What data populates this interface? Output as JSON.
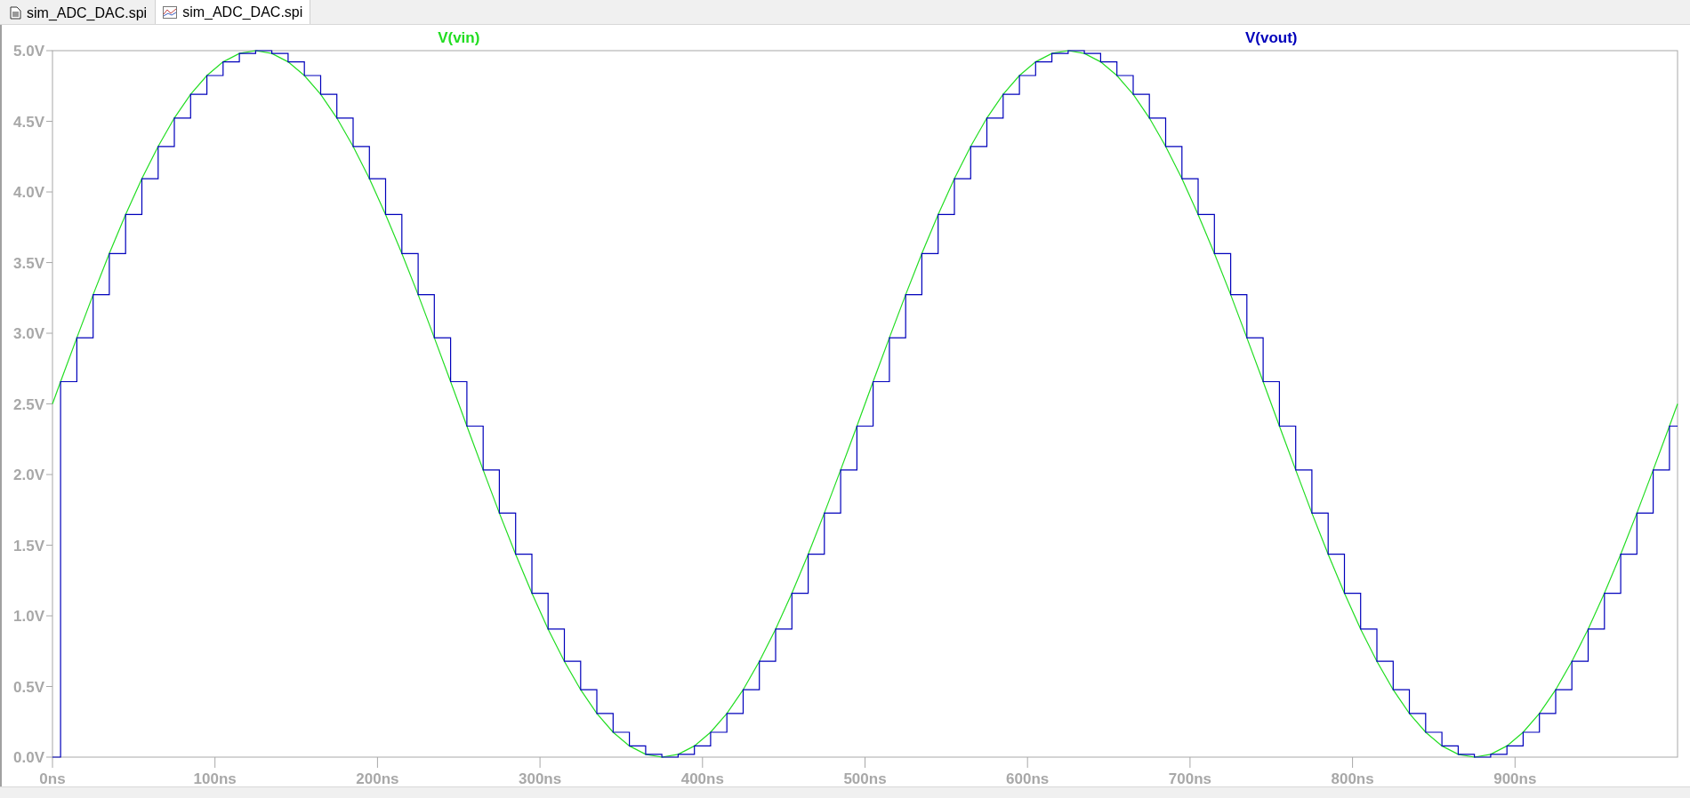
{
  "tabs": [
    {
      "label": "sim_ADC_DAC.spi",
      "kind": "netlist",
      "selected": false
    },
    {
      "label": "sim_ADC_DAC.spi",
      "kind": "waveform",
      "selected": true
    }
  ],
  "plot": {
    "chart_data": {
      "type": "line",
      "xlim": [
        0,
        1000
      ],
      "ylim": [
        0,
        5
      ],
      "xticks": [
        {
          "value": 0,
          "label": "0ns"
        },
        {
          "value": 100,
          "label": "100ns"
        },
        {
          "value": 200,
          "label": "200ns"
        },
        {
          "value": 300,
          "label": "300ns"
        },
        {
          "value": 400,
          "label": "400ns"
        },
        {
          "value": 500,
          "label": "500ns"
        },
        {
          "value": 600,
          "label": "600ns"
        },
        {
          "value": 700,
          "label": "700ns"
        },
        {
          "value": 800,
          "label": "800ns"
        },
        {
          "value": 900,
          "label": "900ns"
        }
      ],
      "yticks": [
        {
          "value": 0,
          "label": "0.0V"
        },
        {
          "value": 0.5,
          "label": "0.5V"
        },
        {
          "value": 1,
          "label": "1.0V"
        },
        {
          "value": 1.5,
          "label": "1.5V"
        },
        {
          "value": 2,
          "label": "2.0V"
        },
        {
          "value": 2.5,
          "label": "2.5V"
        },
        {
          "value": 3,
          "label": "3.0V"
        },
        {
          "value": 3.5,
          "label": "3.5V"
        },
        {
          "value": 4,
          "label": "4.0V"
        },
        {
          "value": 4.5,
          "label": "4.5V"
        },
        {
          "value": 5,
          "label": "5.0V"
        }
      ],
      "x": [
        0,
        5,
        5,
        15,
        15,
        25,
        25,
        35,
        35,
        45,
        45,
        55,
        55,
        65,
        65,
        75,
        75,
        85,
        85,
        95,
        95,
        105,
        105,
        115,
        115,
        125,
        125,
        135,
        135,
        145,
        145,
        155,
        155,
        165,
        165,
        175,
        175,
        185,
        185,
        195,
        195,
        205,
        205,
        215,
        215,
        225,
        225,
        235,
        235,
        245,
        245,
        255,
        255,
        265,
        265,
        275,
        275,
        285,
        285,
        295,
        295,
        305,
        305,
        315,
        315,
        325,
        325,
        335,
        335,
        345,
        345,
        355,
        355,
        365,
        365,
        375,
        375,
        385,
        385,
        395,
        395,
        405,
        405,
        415,
        415,
        425,
        425,
        435,
        435,
        445,
        445,
        455,
        455,
        465,
        465,
        475,
        475,
        485,
        485,
        495,
        495,
        505,
        505,
        515,
        515,
        525,
        525,
        535,
        535,
        545,
        545,
        555,
        555,
        565,
        565,
        575,
        575,
        585,
        585,
        595,
        595,
        605,
        605,
        615,
        615,
        625,
        625,
        635,
        635,
        645,
        645,
        655,
        655,
        665,
        665,
        675,
        675,
        685,
        685,
        695,
        695,
        705,
        705,
        715,
        715,
        725,
        725,
        735,
        735,
        745,
        745,
        755,
        755,
        765,
        765,
        775,
        775,
        785,
        785,
        795,
        795,
        805,
        805,
        815,
        815,
        825,
        825,
        835,
        835,
        845,
        845,
        855,
        855,
        865,
        865,
        875,
        875,
        885,
        885,
        895,
        895,
        905,
        905,
        915,
        915,
        925,
        925,
        935,
        935,
        945,
        945,
        955,
        955,
        965,
        965,
        975,
        975,
        985,
        985,
        995,
        995,
        1000
      ],
      "series": [
        {
          "name": "V(vin)",
          "color": "#22dd22",
          "values": [
            2.5,
            2.657,
            2.657,
            2.968,
            2.968,
            3.273,
            3.273,
            3.564,
            3.564,
            3.84,
            3.84,
            4.094,
            4.094,
            4.322,
            4.322,
            4.523,
            4.523,
            4.691,
            4.691,
            4.824,
            4.824,
            4.921,
            4.921,
            4.98,
            4.98,
            5.0,
            5.0,
            4.98,
            4.98,
            4.921,
            4.921,
            4.824,
            4.824,
            4.691,
            4.691,
            4.523,
            4.523,
            4.322,
            4.322,
            4.094,
            4.094,
            3.84,
            3.84,
            3.564,
            3.564,
            3.273,
            3.273,
            2.968,
            2.968,
            2.657,
            2.657,
            2.343,
            2.343,
            2.032,
            2.032,
            1.727,
            1.727,
            1.436,
            1.436,
            1.16,
            1.16,
            0.906,
            0.906,
            0.678,
            0.678,
            0.477,
            0.477,
            0.309,
            0.309,
            0.176,
            0.176,
            0.079,
            0.079,
            0.02,
            0.02,
            0.0,
            0.0,
            0.02,
            0.02,
            0.079,
            0.079,
            0.176,
            0.176,
            0.309,
            0.309,
            0.477,
            0.477,
            0.678,
            0.678,
            0.906,
            0.906,
            1.16,
            1.16,
            1.436,
            1.436,
            1.727,
            1.727,
            2.032,
            2.032,
            2.343,
            2.343,
            2.657,
            2.657,
            2.968,
            2.968,
            3.273,
            3.273,
            3.564,
            3.564,
            3.84,
            3.84,
            4.094,
            4.094,
            4.322,
            4.322,
            4.523,
            4.523,
            4.691,
            4.691,
            4.824,
            4.824,
            4.921,
            4.921,
            4.98,
            4.98,
            5.0,
            5.0,
            4.98,
            4.98,
            4.921,
            4.921,
            4.824,
            4.824,
            4.691,
            4.691,
            4.523,
            4.523,
            4.322,
            4.322,
            4.094,
            4.094,
            3.84,
            3.84,
            3.564,
            3.564,
            3.273,
            3.273,
            2.968,
            2.968,
            2.657,
            2.657,
            2.343,
            2.343,
            2.032,
            2.032,
            1.727,
            1.727,
            1.436,
            1.436,
            1.16,
            1.16,
            0.906,
            0.906,
            0.678,
            0.678,
            0.477,
            0.477,
            0.309,
            0.309,
            0.176,
            0.176,
            0.079,
            0.079,
            0.02,
            0.02,
            0.0,
            0.0,
            0.02,
            0.02,
            0.079,
            0.079,
            0.176,
            0.176,
            0.309,
            0.309,
            0.477,
            0.477,
            0.678,
            0.678,
            0.906,
            0.906,
            1.16,
            1.16,
            1.436,
            1.436,
            1.727,
            1.727,
            2.032,
            2.032,
            2.343,
            2.343,
            2.5
          ]
        },
        {
          "name": "V(vout)",
          "color": "#0000bb",
          "values": [
            0.0,
            0.0,
            2.657,
            2.657,
            2.968,
            2.968,
            3.273,
            3.273,
            3.564,
            3.564,
            3.84,
            3.84,
            4.094,
            4.094,
            4.322,
            4.322,
            4.523,
            4.523,
            4.691,
            4.691,
            4.824,
            4.824,
            4.921,
            4.921,
            4.98,
            4.98,
            5.0,
            5.0,
            4.98,
            4.98,
            4.921,
            4.921,
            4.824,
            4.824,
            4.691,
            4.691,
            4.523,
            4.523,
            4.322,
            4.322,
            4.094,
            4.094,
            3.84,
            3.84,
            3.564,
            3.564,
            3.273,
            3.273,
            2.968,
            2.968,
            2.657,
            2.657,
            2.343,
            2.343,
            2.032,
            2.032,
            1.727,
            1.727,
            1.436,
            1.436,
            1.16,
            1.16,
            0.906,
            0.906,
            0.678,
            0.678,
            0.477,
            0.477,
            0.309,
            0.309,
            0.176,
            0.176,
            0.079,
            0.079,
            0.02,
            0.02,
            0.0,
            0.0,
            0.02,
            0.02,
            0.079,
            0.079,
            0.176,
            0.176,
            0.309,
            0.309,
            0.477,
            0.477,
            0.678,
            0.678,
            0.906,
            0.906,
            1.16,
            1.16,
            1.436,
            1.436,
            1.727,
            1.727,
            2.032,
            2.032,
            2.343,
            2.343,
            2.657,
            2.657,
            2.968,
            2.968,
            3.273,
            3.273,
            3.564,
            3.564,
            3.84,
            3.84,
            4.094,
            4.094,
            4.322,
            4.322,
            4.523,
            4.523,
            4.691,
            4.691,
            4.824,
            4.824,
            4.921,
            4.921,
            4.98,
            4.98,
            5.0,
            5.0,
            4.98,
            4.98,
            4.921,
            4.921,
            4.824,
            4.824,
            4.691,
            4.691,
            4.523,
            4.523,
            4.322,
            4.322,
            4.094,
            4.094,
            3.84,
            3.84,
            3.564,
            3.564,
            3.273,
            3.273,
            2.968,
            2.968,
            2.657,
            2.657,
            2.343,
            2.343,
            2.032,
            2.032,
            1.727,
            1.727,
            1.436,
            1.436,
            1.16,
            1.16,
            0.906,
            0.906,
            0.678,
            0.678,
            0.477,
            0.477,
            0.309,
            0.309,
            0.176,
            0.176,
            0.079,
            0.079,
            0.02,
            0.02,
            0.0,
            0.0,
            0.02,
            0.02,
            0.079,
            0.079,
            0.176,
            0.176,
            0.309,
            0.309,
            0.477,
            0.477,
            0.678,
            0.678,
            0.906,
            0.906,
            1.16,
            1.16,
            1.436,
            1.436,
            1.727,
            1.727,
            2.032,
            2.032,
            2.343,
            2.343
          ]
        }
      ]
    }
  }
}
